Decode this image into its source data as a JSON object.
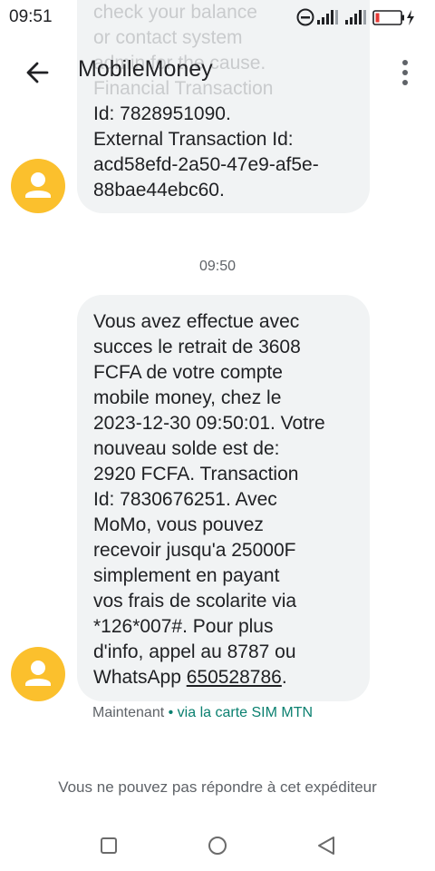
{
  "status_bar": {
    "time": "09:51",
    "icons": [
      "do-not-disturb-icon",
      "signal-icon",
      "signal-icon",
      "battery-charging-icon"
    ]
  },
  "toolbar": {
    "title": "MobileMoney",
    "back_icon": "arrow-back-icon",
    "menu_icon": "more-vert-icon"
  },
  "messages": [
    {
      "text_faded": "check your balance\nor contact system\nadmin for the cause.\nFinancial Transaction",
      "text": "Id: 7828951090.\nExternal Transaction Id:\nacd58efd-2a50-47e9-af5e-\n88bae44ebc60."
    },
    {
      "timestamp": "09:50",
      "text": "Vous avez effectue avec\nsucces le retrait de 3608\nFCFA de votre compte\nmobile money, chez  le\n2023-12-30 09:50:01. Votre\nnouveau solde est de:\n2920 FCFA. Transaction\nId: 7830676251. Avec\nMoMo, vous pouvez\nrecevoir jusqu'a 25000F\nsimplement en payant\nvos frais de scolarite via\n*126*007#. Pour plus\nd'info, appel au 8787 ou\nWhatsApp ",
      "link": "650528786",
      "text_end": ".",
      "sent_label": "Maintenant",
      "sim_label": " • via la carte SIM MTN"
    }
  ],
  "footer": {
    "no_reply": "Vous ne pouvez pas répondre à cet expéditeur"
  },
  "colors": {
    "avatar": "#fbc02d",
    "bubble": "#f1f3f4",
    "sim_label": "#0b8070"
  }
}
